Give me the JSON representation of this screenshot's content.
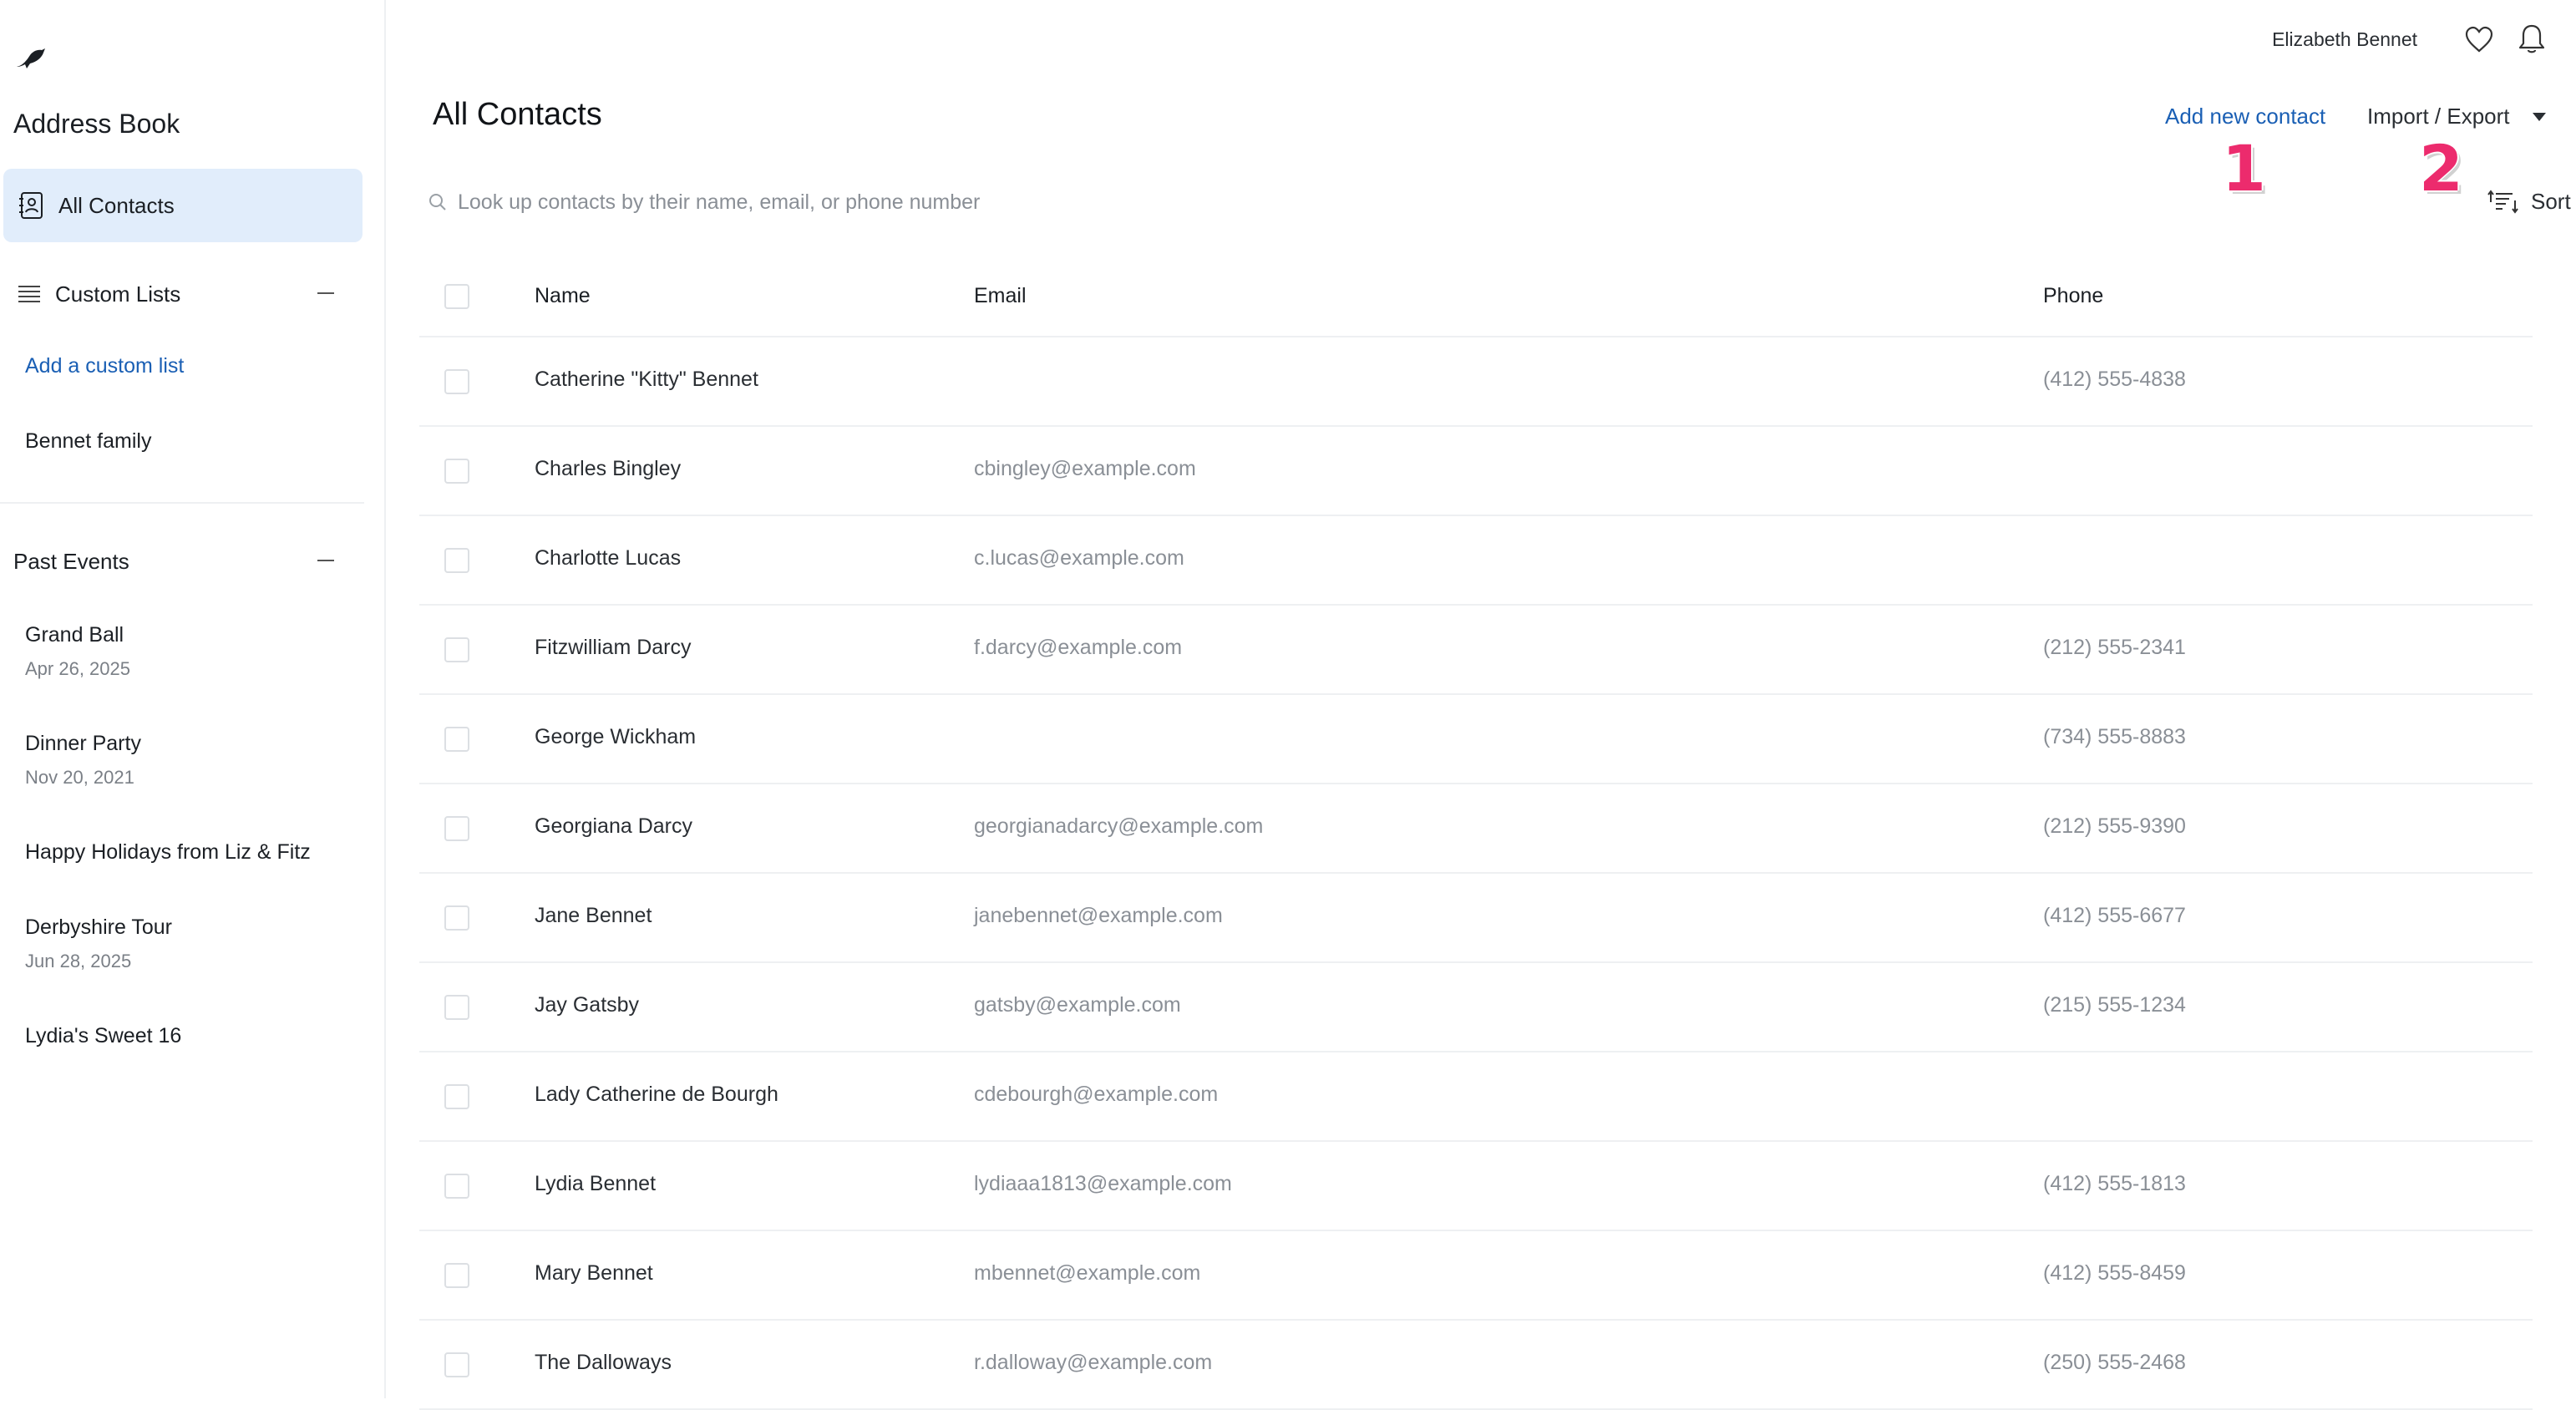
{
  "app": {
    "title": "Address Book"
  },
  "sidebar": {
    "all_contacts": "All Contacts",
    "custom_lists": {
      "label": "Custom Lists",
      "add_link": "Add a custom list",
      "items": [
        "Bennet family"
      ]
    },
    "past_events": {
      "label": "Past Events",
      "items": [
        {
          "name": "Grand Ball",
          "date": "Apr 26, 2025"
        },
        {
          "name": "Dinner Party",
          "date": "Nov 20, 2021"
        },
        {
          "name": "Happy Holidays from Liz & Fitz",
          "date": ""
        },
        {
          "name": "Derbyshire Tour",
          "date": "Jun 28, 2025"
        },
        {
          "name": "Lydia's Sweet 16",
          "date": ""
        }
      ]
    }
  },
  "header": {
    "user_name": "Elizabeth Bennet"
  },
  "main": {
    "title": "All Contacts",
    "add_contact": "Add new contact",
    "import_export": "Import / Export",
    "markers": [
      "1",
      "2"
    ],
    "search": {
      "placeholder": "Look up contacts by their name, email, or phone number",
      "value": ""
    },
    "sort_label": "Sort",
    "table": {
      "columns": [
        "Name",
        "Email",
        "Phone"
      ],
      "rows": [
        {
          "name": "Catherine \"Kitty\" Bennet",
          "email": "",
          "phone": "(412) 555-4838"
        },
        {
          "name": "Charles Bingley",
          "email": "cbingley@example.com",
          "phone": ""
        },
        {
          "name": "Charlotte Lucas",
          "email": "c.lucas@example.com",
          "phone": ""
        },
        {
          "name": "Fitzwilliam Darcy",
          "email": "f.darcy@example.com",
          "phone": "(212) 555-2341"
        },
        {
          "name": "George Wickham",
          "email": "",
          "phone": "(734) 555-8883"
        },
        {
          "name": "Georgiana Darcy",
          "email": "georgianadarcy@example.com",
          "phone": "(212) 555-9390"
        },
        {
          "name": "Jane Bennet",
          "email": "janebennet@example.com",
          "phone": "(412) 555-6677"
        },
        {
          "name": "Jay Gatsby",
          "email": "gatsby@example.com",
          "phone": "(215) 555-1234"
        },
        {
          "name": "Lady Catherine de Bourgh",
          "email": "cdebourgh@example.com",
          "phone": ""
        },
        {
          "name": "Lydia Bennet",
          "email": "lydiaaa1813@example.com",
          "phone": "(412) 555-1813"
        },
        {
          "name": "Mary Bennet",
          "email": "mbennet@example.com",
          "phone": "(412) 555-8459"
        },
        {
          "name": "The Dalloways",
          "email": "r.dalloway@example.com",
          "phone": "(250) 555-2468"
        }
      ]
    }
  },
  "colors": {
    "accent": "#1a5fb4",
    "nav_active_bg": "#e1edfb",
    "marker": "#ec2b6d"
  },
  "icons": [
    "bird-logo-icon",
    "contacts-book-icon",
    "list-icon",
    "heart-icon",
    "bell-icon",
    "search-icon",
    "sort-icon",
    "caret-down-icon"
  ]
}
